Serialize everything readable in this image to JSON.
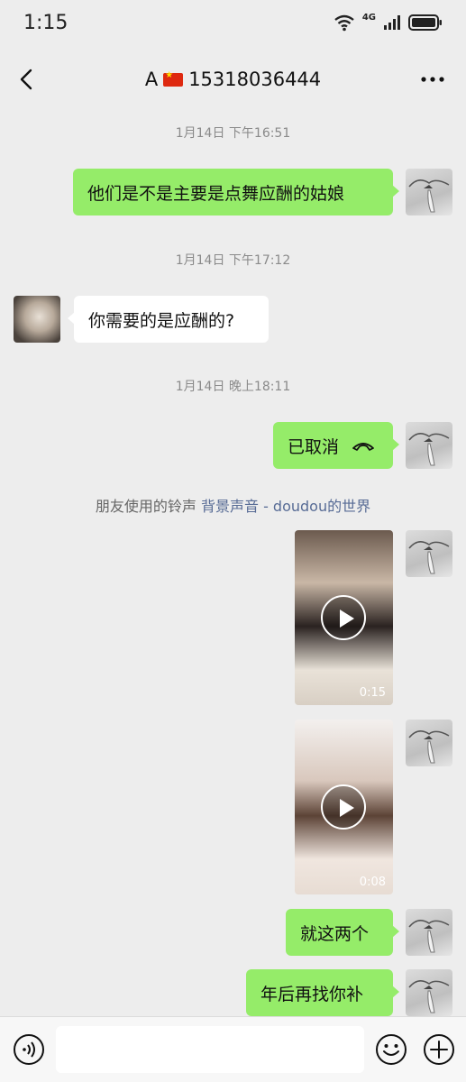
{
  "status_bar": {
    "time": "1:15",
    "network": "4G"
  },
  "header": {
    "title_prefix": "A",
    "title_phone": "15318036444",
    "back_icon": "chevron-left-icon",
    "more_icon": "more-dots-icon"
  },
  "messages": {
    "ts1": "1月14日 下午16:51",
    "msg1": "他们是不是主要是点舞应酬的姑娘",
    "ts2": "1月14日 下午17:12",
    "msg2": "你需要的是应酬的?",
    "ts3": "1月14日 晚上18:11",
    "call_text": "已取消",
    "ring_prefix": "朋友使用的铃声",
    "ring_link": "背景声音 - doudou的世界",
    "video1_duration": "0:15",
    "video2_duration": "0:08",
    "msg3": "就这两个",
    "msg4": "年后再找你补"
  },
  "input_bar": {
    "placeholder": ""
  },
  "colors": {
    "self_bubble": "#95ec69",
    "other_bubble": "#ffffff",
    "background": "#ededed",
    "link": "#576b95"
  }
}
